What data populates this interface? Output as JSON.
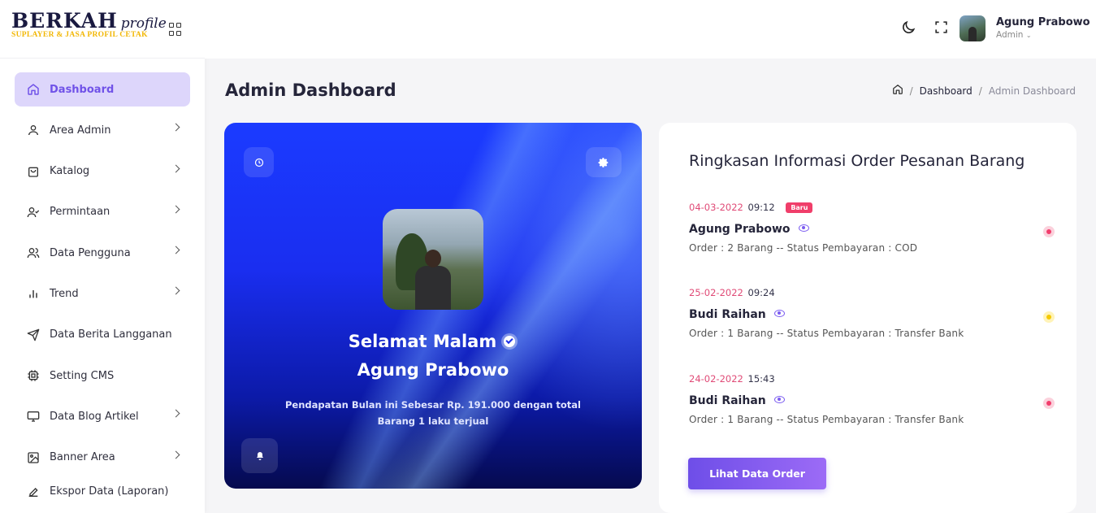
{
  "brand": {
    "name": "BERKAH",
    "script": "profile",
    "tagline": "SUPLAYER & JASA PROFIL CETAK"
  },
  "sidebar": {
    "items": [
      {
        "label": "Dashboard",
        "icon": "home-icon",
        "active": true,
        "has_submenu": false
      },
      {
        "label": "Area Admin",
        "icon": "user-icon",
        "active": false,
        "has_submenu": true
      },
      {
        "label": "Katalog",
        "icon": "shopping-bag-icon",
        "active": false,
        "has_submenu": true
      },
      {
        "label": "Permintaan",
        "icon": "user-check-icon",
        "active": false,
        "has_submenu": true
      },
      {
        "label": "Data Pengguna",
        "icon": "users-icon",
        "active": false,
        "has_submenu": true
      },
      {
        "label": "Trend",
        "icon": "bar-chart-icon",
        "active": false,
        "has_submenu": true
      },
      {
        "label": "Data Berita Langganan",
        "icon": "send-icon",
        "active": false,
        "has_submenu": false
      },
      {
        "label": "Setting CMS",
        "icon": "cpu-icon",
        "active": false,
        "has_submenu": false
      },
      {
        "label": "Data Blog Artikel",
        "icon": "monitor-icon",
        "active": false,
        "has_submenu": true
      },
      {
        "label": "Banner Area",
        "icon": "image-icon",
        "active": false,
        "has_submenu": true
      },
      {
        "label": "Ekspor Data (Laporan)",
        "icon": "edit-icon",
        "active": false,
        "has_submenu": false
      }
    ]
  },
  "header": {
    "user_name": "Agung Prabowo",
    "user_role": "Admin"
  },
  "page": {
    "title": "Admin Dashboard",
    "breadcrumb": [
      "Dashboard",
      "Admin Dashboard"
    ]
  },
  "hero": {
    "greeting": "Selamat Malam",
    "name": "Agung Prabowo",
    "description": "Pendapatan Bulan ini Sebesar Rp. 191.000 dengan total Barang 1 laku terjual"
  },
  "orders": {
    "title": "Ringkasan Informasi Order Pesanan Barang",
    "new_badge": "Baru",
    "button_label": "Lihat Data Order",
    "items": [
      {
        "date": "04-03-2022",
        "time": "09:12",
        "is_new": true,
        "name": "Agung Prabowo",
        "detail": "Order : 2 Barang -- Status Pembayaran : COD",
        "status_color": "#f23d6c"
      },
      {
        "date": "25-02-2022",
        "time": "09:24",
        "is_new": false,
        "name": "Budi Raihan",
        "detail": "Order : 1 Barang -- Status Pembayaran : Transfer Bank",
        "status_color": "#f5c900"
      },
      {
        "date": "24-02-2022",
        "time": "15:43",
        "is_new": false,
        "name": "Budi Raihan",
        "detail": "Order : 1 Barang -- Status Pembayaran : Transfer Bank",
        "status_color": "#f23d6c"
      }
    ]
  },
  "colors": {
    "accent": "#7052e8",
    "active_bg": "#ddd6fb",
    "hero_blue": "#1b3bff"
  }
}
